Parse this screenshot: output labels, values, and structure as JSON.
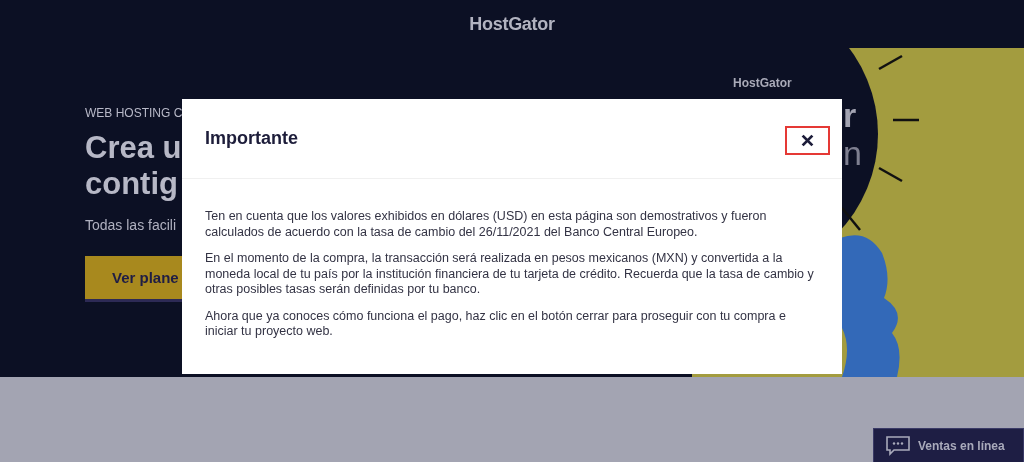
{
  "header": {
    "logo": "HostGator"
  },
  "hero": {
    "eyebrow": "WEB HOSTING C",
    "heading_lines": [
      "Crea u",
      "contig"
    ],
    "subtitle": "Todas las facili",
    "button": "Ver plane",
    "illustration": {
      "logo": "HostGator",
      "heading_fragments": [
        "r",
        "n"
      ]
    }
  },
  "modal": {
    "title": "Importante",
    "close_button": {
      "focused": true
    },
    "paragraphs": [
      "Ten en cuenta que los valores exhibidos en dólares (USD) en esta página son demostrativos y fueron calculados de acuerdo con la tasa de cambio del 26/11/2021 del Banco Central Europeo.",
      "En el momento de la compra, la transacción será realizada en pesos mexicanos (MXN) y convertida a la moneda local de tu país por la institución financiera de tu tarjeta de crédito. Recuerda que la tasa de cambio y otras posibles tasas serán definidas por tu banco.",
      "Ahora que ya conoces cómo funciona el pago, haz clic en el botón cerrar para proseguir con tu compra e iniciar tu proyecto web."
    ]
  },
  "chat_button": {
    "label": "Ventas en línea"
  }
}
